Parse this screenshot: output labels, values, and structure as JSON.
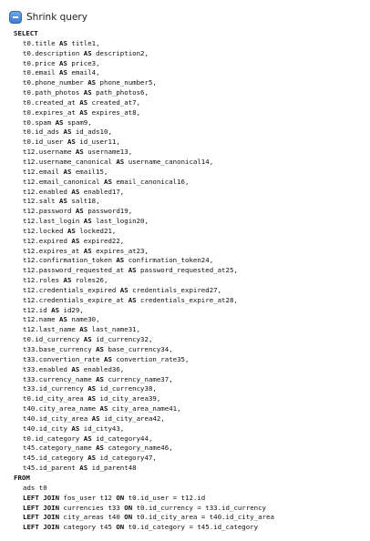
{
  "header": {
    "toggle_icon": "minus-icon",
    "title": "Shrink query"
  },
  "query": {
    "select_keyword": "SELECT",
    "select_lines": [
      "t0.title AS title1,",
      "t0.description AS description2,",
      "t0.price AS price3,",
      "t0.email AS email4,",
      "t0.phone_number AS phone_number5,",
      "t0.path_photos AS path_photos6,",
      "t0.created_at AS created_at7,",
      "t0.expires_at AS expires_at8,",
      "t0.spam AS spam9,",
      "t0.id_ads AS id_ads10,",
      "t0.id_user AS id_user11,",
      "t12.username AS username13,",
      "t12.username_canonical AS username_canonical14,",
      "t12.email AS email15,",
      "t12.email_canonical AS email_canonical16,",
      "t12.enabled AS enabled17,",
      "t12.salt AS salt18,",
      "t12.password AS password19,",
      "t12.last_login AS last_login20,",
      "t12.locked AS locked21,",
      "t12.expired AS expired22,",
      "t12.expires_at AS expires_at23,",
      "t12.confirmation_token AS confirmation_token24,",
      "t12.password_requested_at AS password_requested_at25,",
      "t12.roles AS roles26,",
      "t12.credentials_expired AS credentials_expired27,",
      "t12.credentials_expire_at AS credentials_expire_at28,",
      "t12.id AS id29,",
      "t12.name AS name30,",
      "t12.last_name AS last_name31,",
      "t0.id_currency AS id_currency32,",
      "t33.base_currency AS base_currency34,",
      "t33.convertion_rate AS convertion_rate35,",
      "t33.enabled AS enabled36,",
      "t33.currency_name AS currency_name37,",
      "t33.id_currency AS id_currency38,",
      "t0.id_city_area AS id_city_area39,",
      "t40.city_area_name AS city_area_name41,",
      "t40.id_city_area AS id_city_area42,",
      "t40.id_city AS id_city43,",
      "t0.id_category AS id_category44,",
      "t45.category_name AS category_name46,",
      "t45.id_category AS id_category47,",
      "t45.id_parent AS id_parent48"
    ],
    "from_keyword": "FROM",
    "from_table": "ads t0",
    "joins": [
      "LEFT JOIN fos_user t12 ON t0.id_user = t12.id",
      "LEFT JOIN currencies t33 ON t0.id_currency = t33.id_currency",
      "LEFT JOIN city_areas t40 ON t0.id_city_area = t40.id_city_area",
      "LEFT JOIN category t45 ON t0.id_category = t45.id_category"
    ]
  }
}
